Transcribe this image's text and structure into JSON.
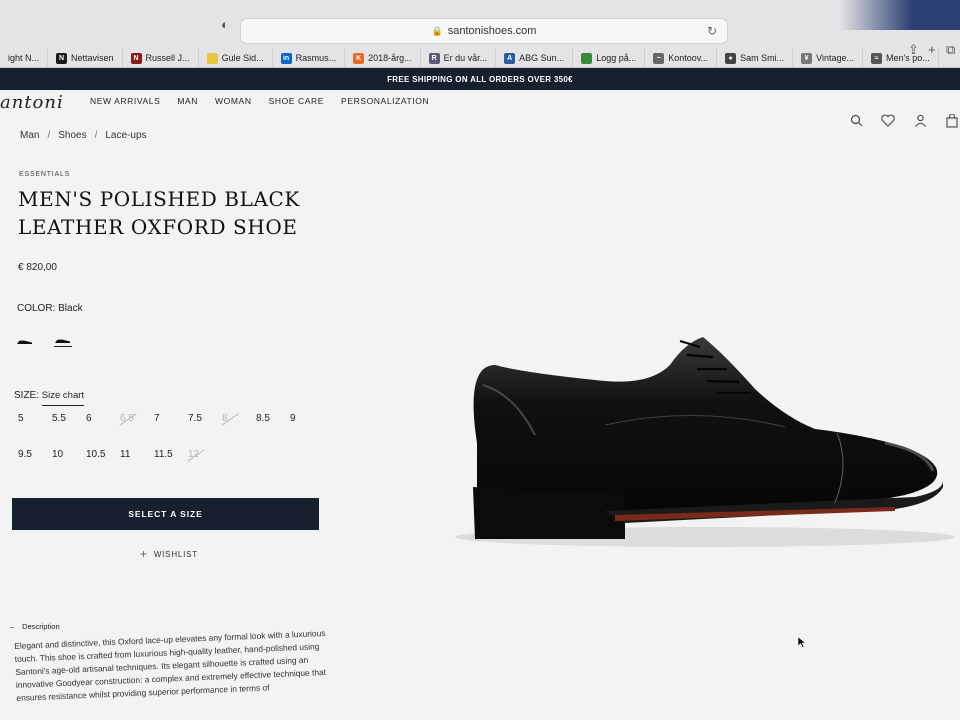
{
  "browser": {
    "url": "santonishoes.com",
    "bookmarks": [
      {
        "label": "ight N...",
        "color": "#888888",
        "glyph": ""
      },
      {
        "label": "Nettavisen",
        "color": "#1a1a1a",
        "glyph": "N"
      },
      {
        "label": "Russell J...",
        "color": "#8b1a1a",
        "glyph": "N"
      },
      {
        "label": "Gule Sid...",
        "color": "#e8c640",
        "glyph": ""
      },
      {
        "label": "Rasmus...",
        "color": "#0a66c2",
        "glyph": "in"
      },
      {
        "label": "2018-årg...",
        "color": "#e86a2b",
        "glyph": "K"
      },
      {
        "label": "Er du vår...",
        "color": "#5a5a7a",
        "glyph": "R"
      },
      {
        "label": "ABG Sun...",
        "color": "#2d5aa0",
        "glyph": "A"
      },
      {
        "label": "Logg på...",
        "color": "#3c8a3c",
        "glyph": ""
      },
      {
        "label": "Kontoov...",
        "color": "#666666",
        "glyph": "~"
      },
      {
        "label": "Sam Smi...",
        "color": "#444444",
        "glyph": "●"
      },
      {
        "label": "Vintage...",
        "color": "#777777",
        "glyph": "¥"
      },
      {
        "label": "Men's po...",
        "color": "#555555",
        "glyph": "≈"
      }
    ]
  },
  "announcement": "FREE SHIPPING ON ALL ORDERS OVER 350€",
  "site": {
    "logo": "antoni",
    "nav": [
      "NEW ARRIVALS",
      "MAN",
      "WOMAN",
      "SHOE CARE",
      "PERSONALIZATION"
    ],
    "utility_icons": [
      "search-icon",
      "heart-icon",
      "user-icon",
      "bag-icon"
    ]
  },
  "breadcrumb": [
    "Man",
    "Shoes",
    "Lace-ups"
  ],
  "product": {
    "eyebrow": "ESSENTIALS",
    "title": "MEN'S POLISHED BLACK LEATHER OXFORD SHOE",
    "price": "€ 820,00",
    "color_label": "COLOR:",
    "color_value": "Black",
    "size_label": "SIZE:",
    "size_chart": "Size chart",
    "sizes": [
      {
        "value": "5",
        "available": true
      },
      {
        "value": "5.5",
        "available": true
      },
      {
        "value": "6",
        "available": true
      },
      {
        "value": "6.5",
        "available": false
      },
      {
        "value": "7",
        "available": true
      },
      {
        "value": "7.5",
        "available": true
      },
      {
        "value": "8",
        "available": false
      },
      {
        "value": "8.5",
        "available": true
      },
      {
        "value": "9",
        "available": true
      },
      {
        "value": "9.5",
        "available": true
      },
      {
        "value": "10",
        "available": true
      },
      {
        "value": "10.5",
        "available": true
      },
      {
        "value": "11",
        "available": true
      },
      {
        "value": "11.5",
        "available": true
      },
      {
        "value": "12",
        "available": false
      }
    ],
    "select_button": "SELECT A SIZE",
    "wishlist": "WISHLIST",
    "description_heading": "Description",
    "description": "Elegant and distinctive, this Oxford lace-up elevates any formal look with a luxurious touch. This shoe is crafted from luxurious high-quality leather, hand-polished using Santoni's age-old artisanal techniques. Its elegant silhouette is crafted using an innovative Goodyear construction: a complex and extremely effective technique that ensures resistance whilst providing superior performance in terms of"
  },
  "colors": {
    "dark": "#16202e",
    "page_bg": "#f3f3f1",
    "unavailable": "#b5b5b5"
  }
}
